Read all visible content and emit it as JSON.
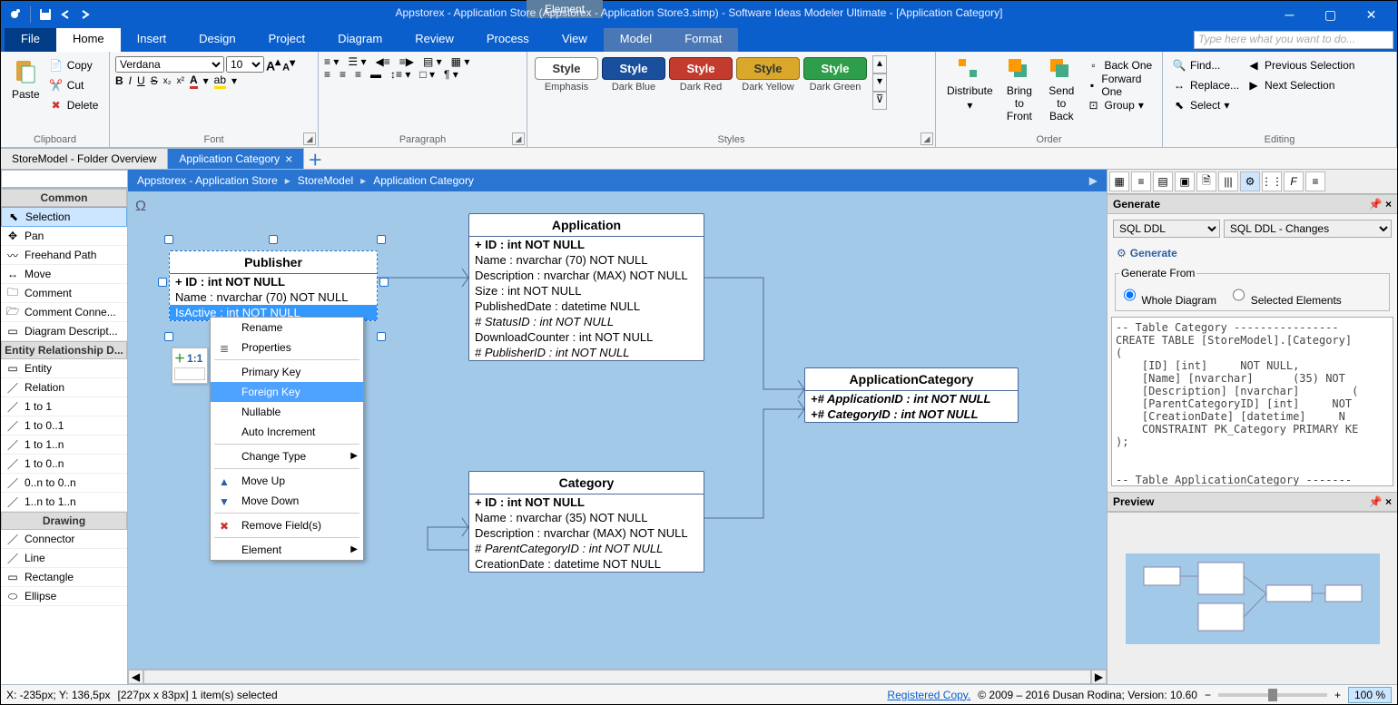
{
  "title": "Appstorex - Application Store (Appstorex - Application Store3.simp)   - Software Ideas Modeler Ultimate - [Application Category]",
  "contextual_tab": "Element",
  "menu": {
    "file": "File",
    "tabs": [
      "Home",
      "Insert",
      "Design",
      "Project",
      "Diagram",
      "Review",
      "Process",
      "View",
      "Model",
      "Format"
    ],
    "active": "Home",
    "search_placeholder": "Type here what you want to do..."
  },
  "ribbon": {
    "clipboard": {
      "paste": "Paste",
      "copy": "Copy",
      "cut": "Cut",
      "delete": "Delete",
      "label": "Clipboard"
    },
    "font": {
      "name": "Verdana",
      "size": "10",
      "label": "Font"
    },
    "paragraph": {
      "label": "Paragraph"
    },
    "styles": {
      "label": "Styles",
      "items": [
        {
          "name": "Emphasis",
          "bg": "#ffffff",
          "fg": "#333",
          "border": "#888"
        },
        {
          "name": "Dark Blue",
          "bg": "#1a4f9c",
          "fg": "#fff",
          "border": "#0d2f66"
        },
        {
          "name": "Dark Red",
          "bg": "#c23b2e",
          "fg": "#fff",
          "border": "#7a1f17"
        },
        {
          "name": "Dark Yellow",
          "bg": "#d9a82b",
          "fg": "#333",
          "border": "#8f6d15"
        },
        {
          "name": "Dark Green",
          "bg": "#2e9e4a",
          "fg": "#fff",
          "border": "#186b2d"
        }
      ],
      "pill": "Style"
    },
    "order": {
      "label": "Order",
      "distribute": "Distribute",
      "bring_front": "Bring to\nFront",
      "send_back": "Send to\nBack",
      "back_one": "Back One",
      "forward_one": "Forward One",
      "group": "Group"
    },
    "editing": {
      "label": "Editing",
      "find": "Find...",
      "replace": "Replace...",
      "select": "Select",
      "prev_sel": "Previous Selection",
      "next_sel": "Next Selection"
    }
  },
  "doc_tabs": {
    "tab1": "StoreModel - Folder Overview",
    "tab2": "Application Category"
  },
  "breadcrumb": [
    "Appstorex - Application Store",
    "StoreModel",
    "Application Category"
  ],
  "toolbox": {
    "common": {
      "label": "Common",
      "items": [
        "Selection",
        "Pan",
        "Freehand Path",
        "Move",
        "Comment",
        "Comment Conne...",
        "Diagram Descript..."
      ]
    },
    "erd": {
      "label": "Entity Relationship D...",
      "items": [
        "Entity",
        "Relation",
        "1 to 1",
        "1 to 0..1",
        "1 to 1..n",
        "1 to 0..n",
        "0..n to 0..n",
        "1..n to 1..n"
      ]
    },
    "drawing": {
      "label": "Drawing",
      "items": [
        "Connector",
        "Line",
        "Rectangle",
        "Ellipse"
      ]
    }
  },
  "entities": {
    "publisher": {
      "title": "Publisher",
      "rows": [
        {
          "text": "+ ID : int NOT NULL",
          "bold": true
        },
        {
          "text": "Name : nvarchar (70)  NOT NULL"
        },
        {
          "text": "IsActive : int NOT NULL",
          "sel": true
        }
      ]
    },
    "application": {
      "title": "Application",
      "rows": [
        {
          "text": "+ ID : int NOT NULL",
          "bold": true
        },
        {
          "text": "Name : nvarchar (70)  NOT NULL"
        },
        {
          "text": "Description : nvarchar (MAX)  NOT NULL"
        },
        {
          "text": "Size : int NOT NULL"
        },
        {
          "text": "PublishedDate : datetime NULL"
        },
        {
          "text": "# StatusID : int NOT NULL",
          "fk": true
        },
        {
          "text": "DownloadCounter : int NOT NULL"
        },
        {
          "text": "# PublisherID : int NOT NULL",
          "fk": true
        }
      ]
    },
    "category": {
      "title": "Category",
      "rows": [
        {
          "text": "+ ID : int NOT NULL",
          "bold": true
        },
        {
          "text": "Name : nvarchar (35)  NOT NULL"
        },
        {
          "text": "Description : nvarchar (MAX)  NOT NULL"
        },
        {
          "text": "# ParentCategoryID : int NOT NULL",
          "fk": true
        },
        {
          "text": "CreationDate : datetime NOT NULL"
        }
      ]
    },
    "appcat": {
      "title": "ApplicationCategory",
      "rows": [
        {
          "text": "+# ApplicationID : int NOT NULL",
          "bold": true,
          "fk": true
        },
        {
          "text": "+# CategoryID : int NOT NULL",
          "bold": true,
          "fk": true
        }
      ]
    }
  },
  "mini_card": {
    "text": "1:1"
  },
  "context_menu": {
    "items": [
      {
        "label": "Rename"
      },
      {
        "label": "Properties",
        "icon": "props"
      },
      {
        "sep": true
      },
      {
        "label": "Primary Key"
      },
      {
        "label": "Foreign Key",
        "hover": true
      },
      {
        "label": "Nullable"
      },
      {
        "label": "Auto Increment"
      },
      {
        "sep": true
      },
      {
        "label": "Change Type",
        "arrow": true
      },
      {
        "sep": true
      },
      {
        "label": "Move Up",
        "icon": "up"
      },
      {
        "label": "Move Down",
        "icon": "down"
      },
      {
        "sep": true
      },
      {
        "label": "Remove Field(s)",
        "icon": "remove"
      },
      {
        "sep": true
      },
      {
        "label": "Element",
        "arrow": true
      }
    ]
  },
  "right": {
    "generate": "Generate",
    "format1": "SQL DDL",
    "format2": "SQL DDL - Changes",
    "generate_btn": "Generate",
    "generate_from": "Generate From",
    "whole": "Whole Diagram",
    "selected": "Selected Elements",
    "code": "-- Table Category ----------------\nCREATE TABLE [StoreModel].[Category]\n(\n    [ID] [int]     NOT NULL,\n    [Name] [nvarchar]      (35) NOT\n    [Description] [nvarchar]        (\n    [ParentCategoryID] [int]     NOT\n    [CreationDate] [datetime]     N\n    CONSTRAINT PK_Category PRIMARY KE\n);\n\n\n-- Table ApplicationCategory -------\nCREATE TABLE [StoreModel].[Applicati\n(\n    [ApplicationID] [int]     NOT N\n    [CategoryID] [int]     NOT NULL,\n    CONSTRAINT PK ApplicationCategory",
    "preview": "Preview"
  },
  "status": {
    "coords": "X: -235px; Y: 136,5px",
    "sel": "[227px x 83px] 1 item(s) selected",
    "registered": "Registered Copy.",
    "copyright": " © 2009 – 2016 Dusan Rodina; Version: 10.60",
    "zoom": "100 %"
  }
}
